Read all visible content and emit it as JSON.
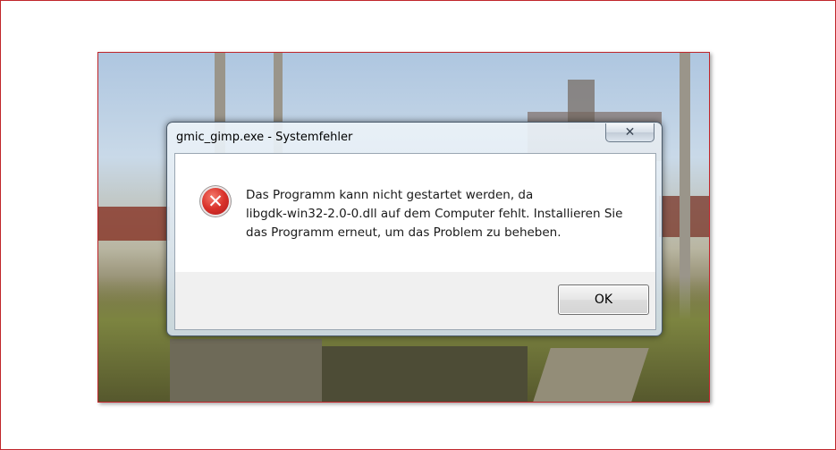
{
  "dialog": {
    "title": "gmic_gimp.exe - Systemfehler",
    "close_label": "✕",
    "icon": "error-icon",
    "icon_glyph": "✕",
    "message": "Das Programm kann nicht gestartet werden, da\nlibgdk-win32-2.0-0.dll auf dem Computer fehlt. Installieren Sie\ndas Programm erneut, um das Problem zu beheben.",
    "ok_label": "OK"
  },
  "colors": {
    "frame_border": "#c0262b",
    "error_red": "#d9322a",
    "dialog_glass": "#d2e0ec"
  }
}
